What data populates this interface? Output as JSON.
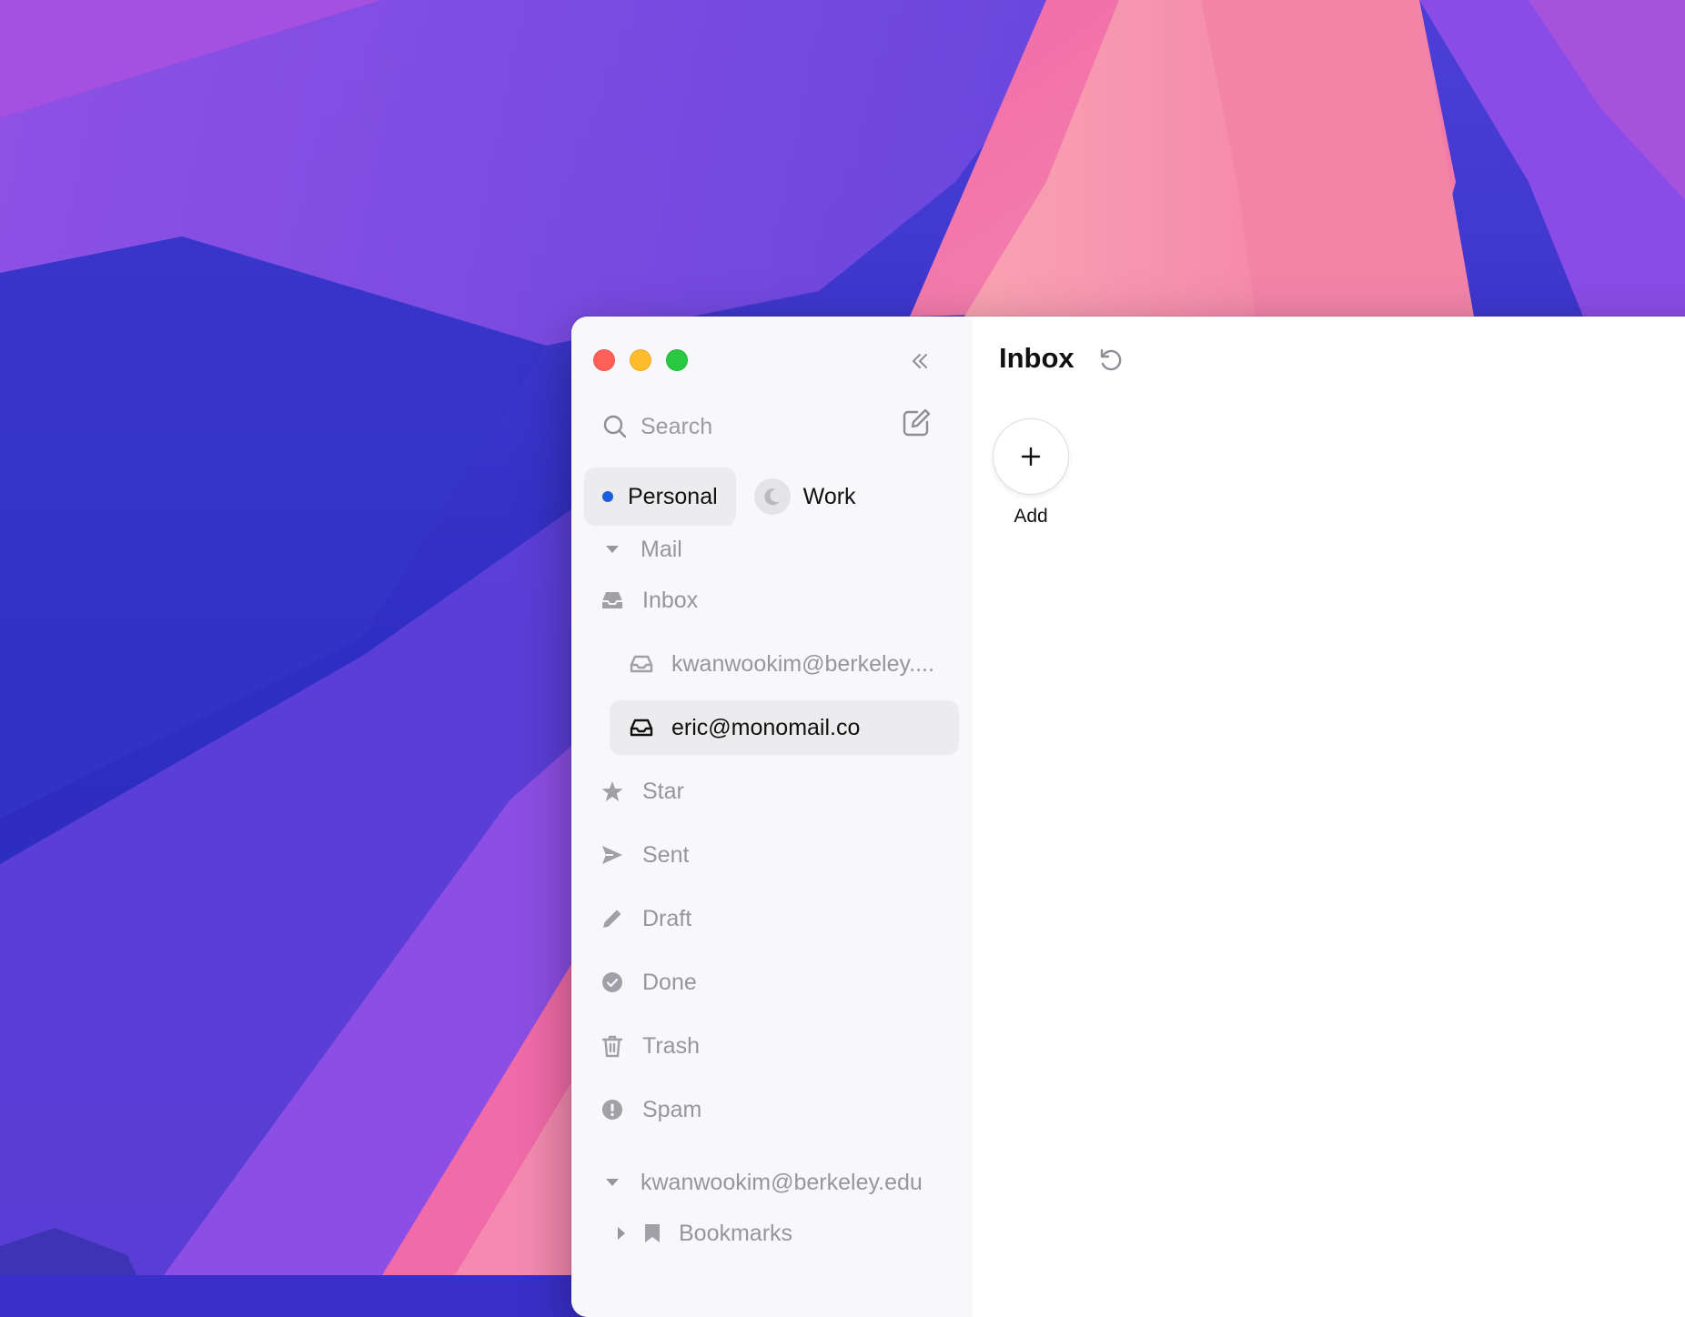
{
  "sidebar": {
    "search_placeholder": "Search",
    "profiles": [
      {
        "label": "Personal",
        "active": true,
        "indicator_color": "#1a5fe0"
      },
      {
        "label": "Work",
        "active": false,
        "icon": "moon-icon"
      }
    ],
    "sections": [
      {
        "label": "Mail",
        "items": [
          {
            "label": "Inbox",
            "icon": "inbox-tray-icon"
          },
          {
            "label": "kwanwookim@berkeley....",
            "icon": "inbox-tray-outline-icon",
            "sub": true
          },
          {
            "label": "eric@monomail.co",
            "icon": "inbox-tray-outline-icon",
            "sub": true,
            "selected": true
          },
          {
            "label": "Star",
            "icon": "star-icon"
          },
          {
            "label": "Sent",
            "icon": "send-icon"
          },
          {
            "label": "Draft",
            "icon": "pencil-icon"
          },
          {
            "label": "Done",
            "icon": "check-circle-icon"
          },
          {
            "label": "Trash",
            "icon": "trash-icon"
          },
          {
            "label": "Spam",
            "icon": "exclamation-circle-icon"
          }
        ]
      },
      {
        "label": "kwanwookim@berkeley.edu",
        "items": [
          {
            "label": "Bookmarks",
            "icon": "bookmark-icon"
          }
        ]
      }
    ]
  },
  "content": {
    "title": "Inbox",
    "add_label": "Add"
  },
  "colors": {
    "accent": "#1a5fe0",
    "close": "#fe5f57",
    "minimize": "#febc2e",
    "maximize": "#28c840"
  }
}
